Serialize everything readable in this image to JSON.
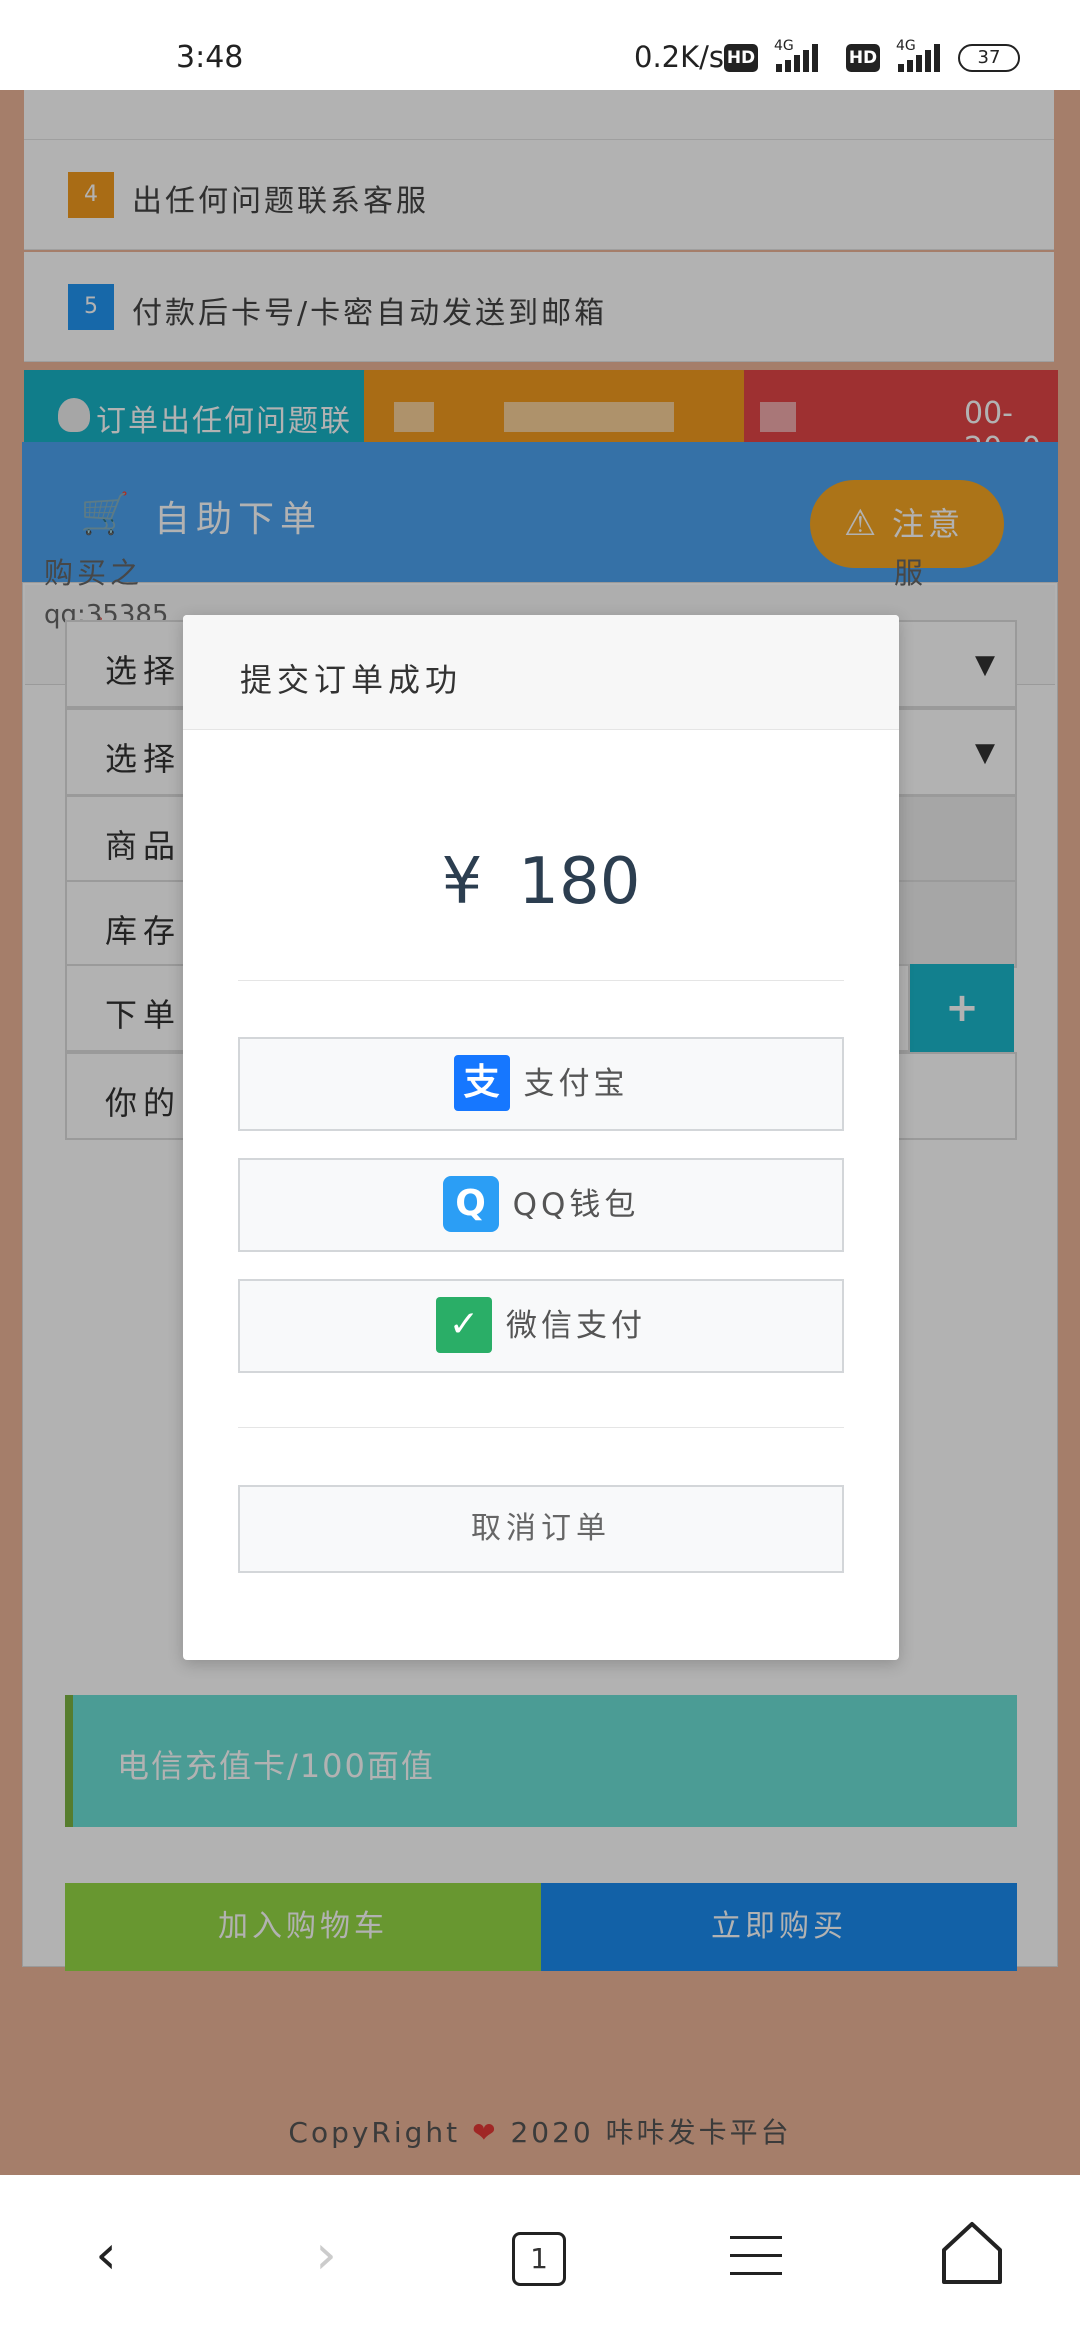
{
  "status_bar": {
    "time": "3:48",
    "network_speed": "0.2K/s",
    "hd_label": "HD",
    "lte_label": "4G",
    "battery": "37"
  },
  "notices": [
    {
      "num": "4",
      "color": "#f29b1f",
      "text": "出任何问题联系客服"
    },
    {
      "num": "5",
      "color": "#2196f3",
      "text": "付款后卡号/卡密自动发送到邮箱"
    }
  ],
  "ticker": {
    "text": "订单出任何问题联",
    "time": "00-20: 0"
  },
  "order_panel": {
    "title": "自助下单",
    "notice_btn": "注意",
    "tab_label": "下单",
    "desc": "购买之",
    "desc_qq": "qq:35385",
    "desc_end": "服",
    "fields": [
      {
        "label": "选择"
      },
      {
        "label": "选择"
      },
      {
        "label": "商品"
      },
      {
        "label": "库存"
      },
      {
        "label": "下单"
      },
      {
        "label": "你的"
      }
    ],
    "product_name": "电信充值卡/100面值",
    "add_cart": "加入购物车",
    "buy_now": "立即购买"
  },
  "footer": {
    "prefix": "CopyRight",
    "suffix": "2020 咔咔发卡平台"
  },
  "modal": {
    "title": "提交订单成功",
    "currency": "¥",
    "amount": "180",
    "pay_options": [
      {
        "label": "支付宝",
        "icon": "alipay-icon",
        "color": "#1677ff",
        "glyph": "支"
      },
      {
        "label": "QQ钱包",
        "icon": "qq-wallet-icon",
        "color": "#2b9ef5",
        "glyph": "Q"
      },
      {
        "label": "微信支付",
        "icon": "wechat-pay-icon",
        "color": "#2aae67",
        "glyph": "✓"
      }
    ],
    "cancel": "取消订单"
  },
  "nav": {
    "tab_count": "1"
  }
}
